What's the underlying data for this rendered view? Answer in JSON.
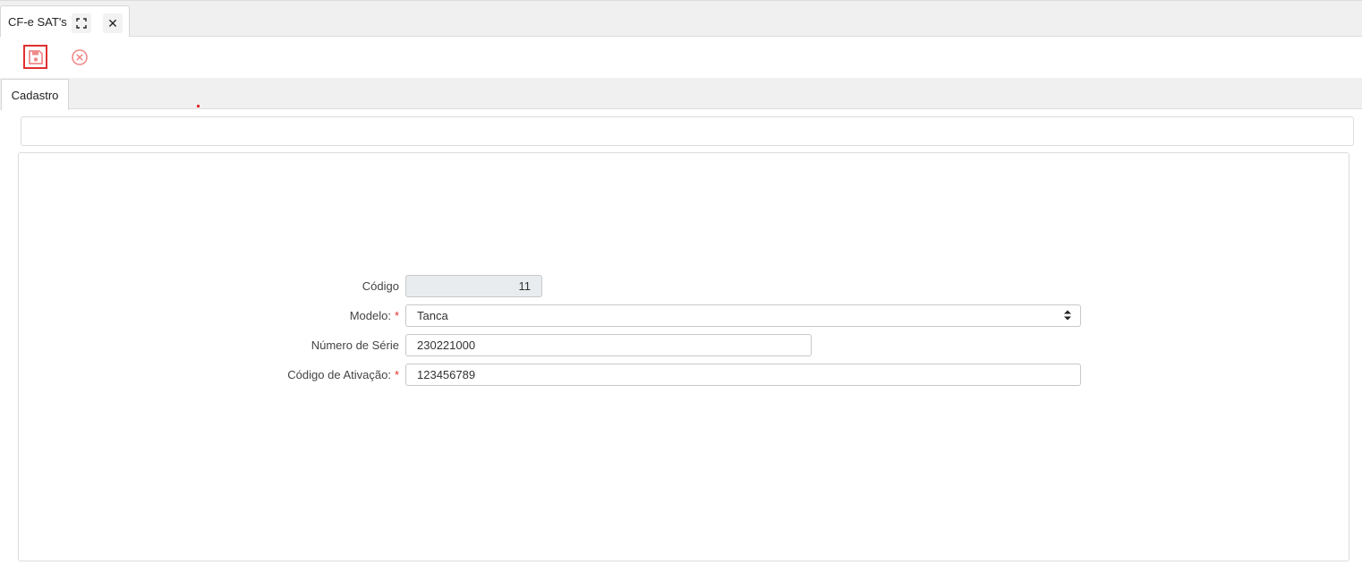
{
  "tabstrip": {
    "doc_tab_title": "CF-e SAT's",
    "expand_icon": "expand-icon",
    "close_icon": "close-icon",
    "close_glyph": "✕"
  },
  "toolbar": {
    "save_icon": "save-icon",
    "cancel_icon": "cancel-icon",
    "accent_color": "#e03030"
  },
  "section_tabs": [
    {
      "label": "Cadastro",
      "active": true
    }
  ],
  "form": {
    "codigo": {
      "label": "Código",
      "value": "11",
      "readonly": true
    },
    "modelo": {
      "label": "Modelo:",
      "required_mark": "*",
      "value": "Tanca"
    },
    "numero_serie": {
      "label": "Número de Série",
      "value": "230221000"
    },
    "codigo_ativacao": {
      "label": "Código de Ativação:",
      "required_mark": "*",
      "value": "123456789"
    }
  }
}
